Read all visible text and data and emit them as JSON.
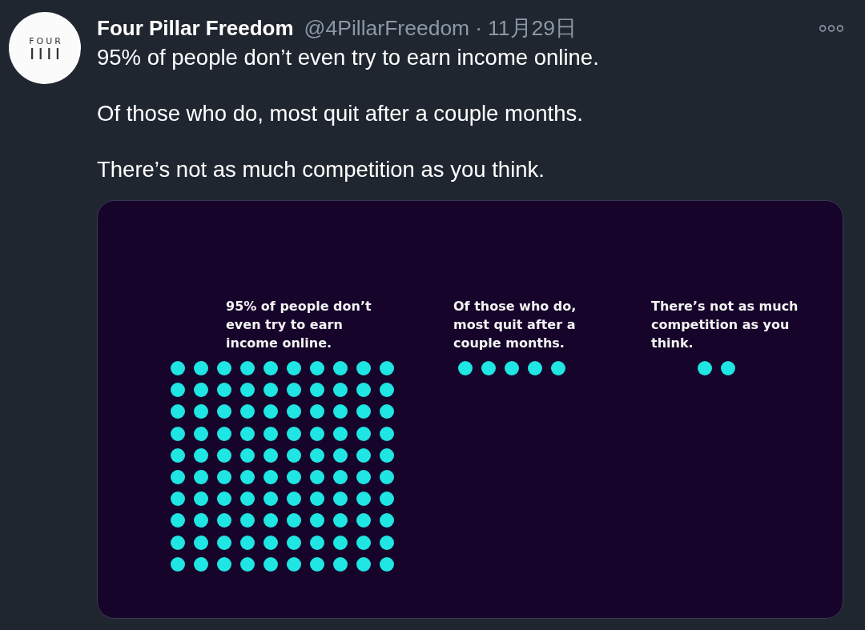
{
  "tweet": {
    "avatar": {
      "logo_text": "FOUR"
    },
    "author": {
      "name": "Four Pillar Freedom",
      "handle": "@4PillarFreedom",
      "separator": "·",
      "date": "11月29日"
    },
    "paragraphs": [
      "95% of people don’t even try to earn income online.",
      "Of those who do, most quit after a couple months.",
      "There’s not as much competition as you think."
    ],
    "media": {
      "panels": [
        {
          "caption": "95% of people don’t even try to earn income online.",
          "dot_rows": [
            [
              {
                "filled": true
              },
              {
                "filled": true
              },
              {
                "filled": true
              },
              {
                "filled": true
              },
              {
                "filled": true
              },
              {
                "filled": true
              },
              {
                "filled": true
              },
              {
                "filled": true
              },
              {
                "filled": true
              },
              {
                "filled": true
              }
            ],
            [
              {
                "filled": true
              },
              {
                "filled": true
              },
              {
                "filled": true
              },
              {
                "filled": true
              },
              {
                "filled": true
              },
              {
                "filled": true
              },
              {
                "filled": true
              },
              {
                "filled": true
              },
              {
                "filled": true
              },
              {
                "filled": true
              }
            ],
            [
              {
                "filled": true
              },
              {
                "filled": true
              },
              {
                "filled": true
              },
              {
                "filled": true
              },
              {
                "filled": true
              },
              {
                "filled": true
              },
              {
                "filled": true
              },
              {
                "filled": true
              },
              {
                "filled": true
              },
              {
                "filled": true
              }
            ],
            [
              {
                "filled": true
              },
              {
                "filled": true
              },
              {
                "filled": true
              },
              {
                "filled": true
              },
              {
                "filled": true
              },
              {
                "filled": true
              },
              {
                "filled": true
              },
              {
                "filled": true
              },
              {
                "filled": true
              },
              {
                "filled": true
              }
            ],
            [
              {
                "filled": true
              },
              {
                "filled": true
              },
              {
                "filled": true
              },
              {
                "filled": true
              },
              {
                "filled": true
              },
              {
                "filled": true
              },
              {
                "filled": true
              },
              {
                "filled": true
              },
              {
                "filled": true
              },
              {
                "filled": true
              }
            ],
            [
              {
                "filled": true
              },
              {
                "filled": true
              },
              {
                "filled": true
              },
              {
                "filled": true
              },
              {
                "filled": true
              },
              {
                "filled": true
              },
              {
                "filled": true
              },
              {
                "filled": true
              },
              {
                "filled": true
              },
              {
                "filled": true
              }
            ],
            [
              {
                "filled": true
              },
              {
                "filled": true
              },
              {
                "filled": true
              },
              {
                "filled": true
              },
              {
                "filled": true
              },
              {
                "filled": true
              },
              {
                "filled": true
              },
              {
                "filled": true
              },
              {
                "filled": true
              },
              {
                "filled": true
              }
            ],
            [
              {
                "filled": true
              },
              {
                "filled": true
              },
              {
                "filled": true
              },
              {
                "filled": true
              },
              {
                "filled": true
              },
              {
                "filled": true
              },
              {
                "filled": true
              },
              {
                "filled": true
              },
              {
                "filled": true
              },
              {
                "filled": true
              }
            ],
            [
              {
                "filled": true
              },
              {
                "filled": true
              },
              {
                "filled": true
              },
              {
                "filled": true
              },
              {
                "filled": true
              },
              {
                "filled": true
              },
              {
                "filled": true
              },
              {
                "filled": true
              },
              {
                "filled": true
              },
              {
                "filled": true
              }
            ],
            [
              {
                "filled": true
              },
              {
                "filled": true
              },
              {
                "filled": true
              },
              {
                "filled": true
              },
              {
                "filled": true
              },
              {
                "filled": true
              },
              {
                "filled": true
              },
              {
                "filled": true
              },
              {
                "filled": true
              },
              {
                "filled": true
              }
            ]
          ]
        },
        {
          "caption": "Of those who do, most quit after a couple months.",
          "dot_rows": [
            [
              {
                "filled": true
              },
              {
                "filled": true
              },
              {
                "filled": true
              },
              {
                "filled": true
              },
              {
                "filled": true
              }
            ]
          ]
        },
        {
          "caption": "There’s not as much competition as you think.",
          "dot_rows": [
            [
              {
                "filled": true
              },
              {
                "filled": true
              }
            ]
          ]
        }
      ]
    }
  }
}
